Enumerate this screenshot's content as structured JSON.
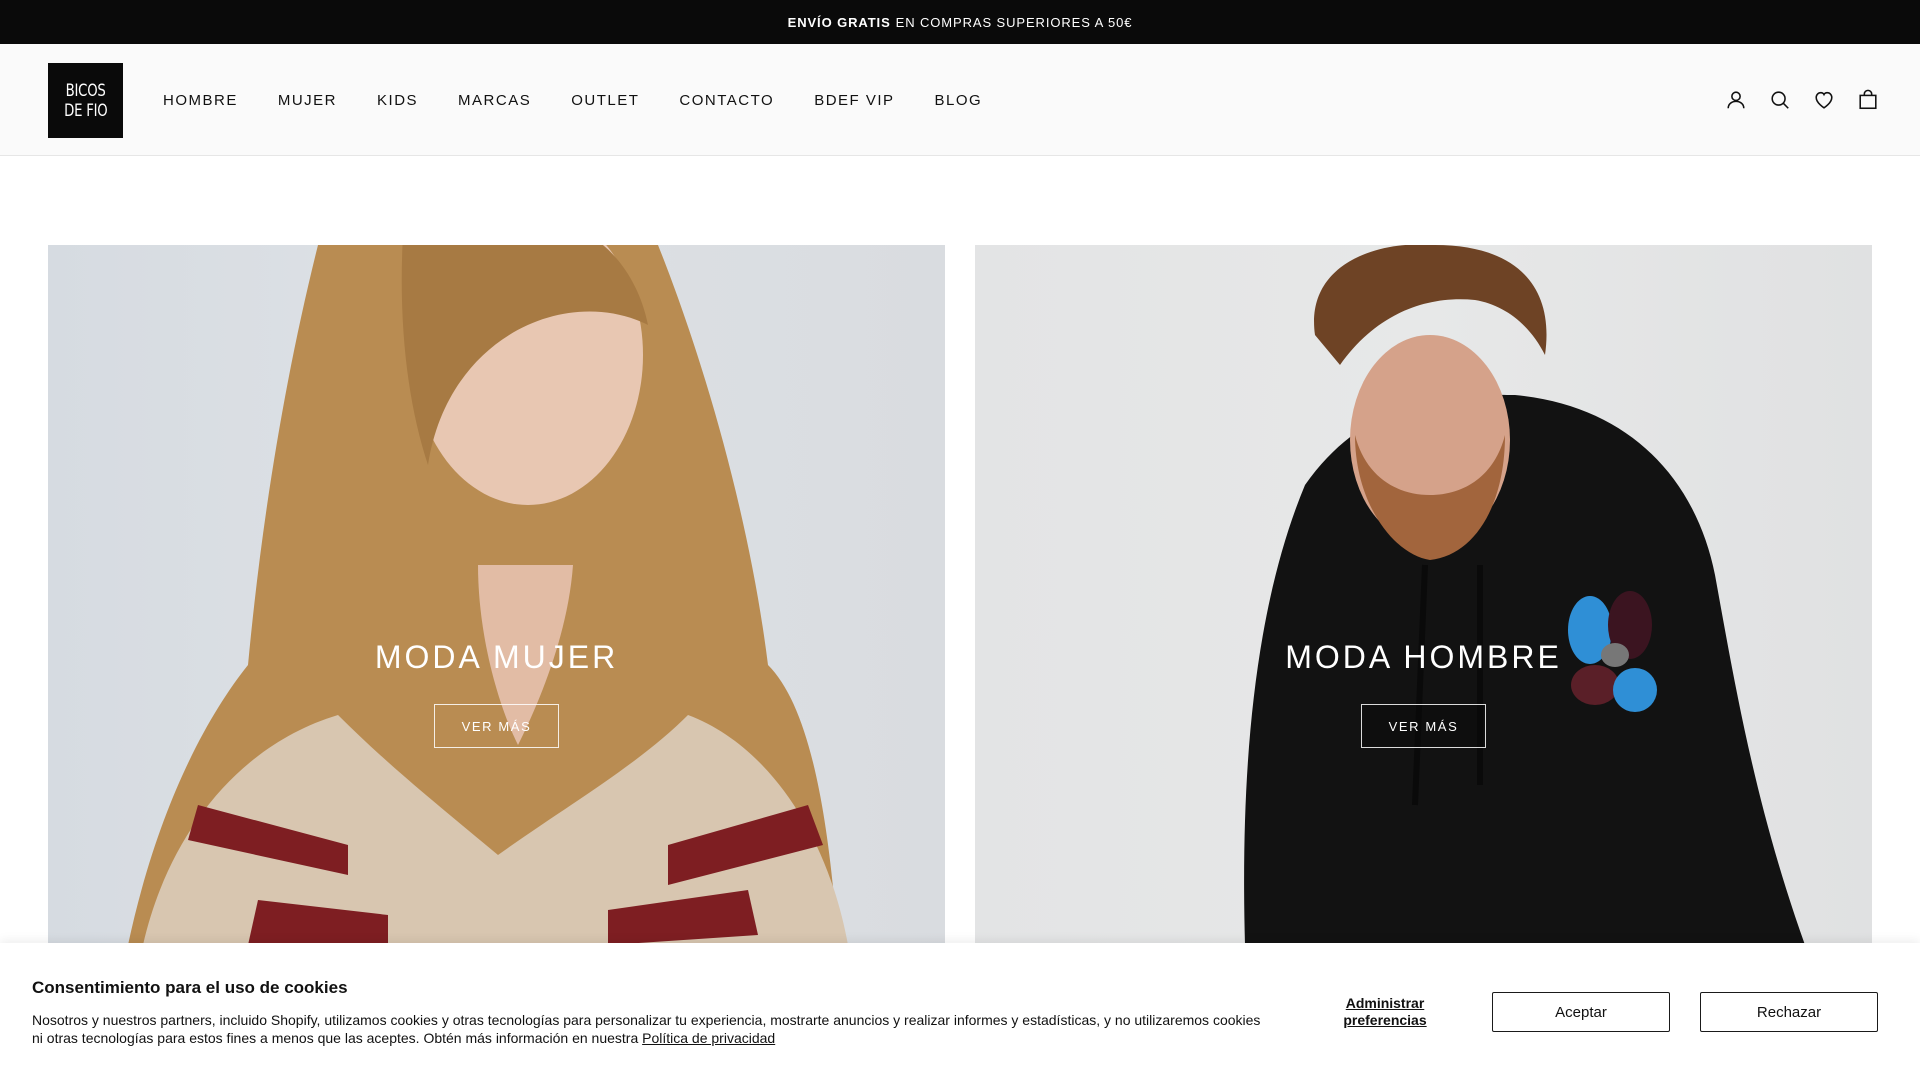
{
  "announcement": {
    "bold": "ENVÍO GRATIS",
    "text": "EN COMPRAS SUPERIORES A 50€"
  },
  "header": {
    "logo": {
      "line1": "BICOS",
      "line2": "DE FIO"
    },
    "nav": [
      {
        "label": "HOMBRE"
      },
      {
        "label": "MUJER"
      },
      {
        "label": "KIDS"
      },
      {
        "label": "MARCAS"
      },
      {
        "label": "OUTLET"
      },
      {
        "label": "CONTACTO"
      },
      {
        "label": "BDEF VIP"
      },
      {
        "label": "BLOG"
      }
    ],
    "icons": [
      "account-icon",
      "search-icon",
      "heart-icon",
      "bag-icon"
    ]
  },
  "heroes": [
    {
      "title": "MODA MUJER",
      "button": "VER MÁS"
    },
    {
      "title": "MODA HOMBRE",
      "button": "VER MÁS"
    }
  ],
  "cookie": {
    "title": "Consentimiento para el uso de cookies",
    "text": "Nosotros y nuestros partners, incluido Shopify, utilizamos cookies y otras tecnologías para personalizar tu experiencia, mostrarte anuncios y realizar informes y estadísticas, y no utilizaremos cookies ni otras tecnologías para estos fines a menos que las aceptes. Obtén más información en nuestra",
    "privacy_link": "Política de privacidad",
    "manage": "Administrar preferencias",
    "accept": "Aceptar",
    "reject": "Rechazar"
  },
  "colors": {
    "topbar": "#0a0a0a",
    "header_bg": "#fafafa",
    "text": "#111111"
  }
}
